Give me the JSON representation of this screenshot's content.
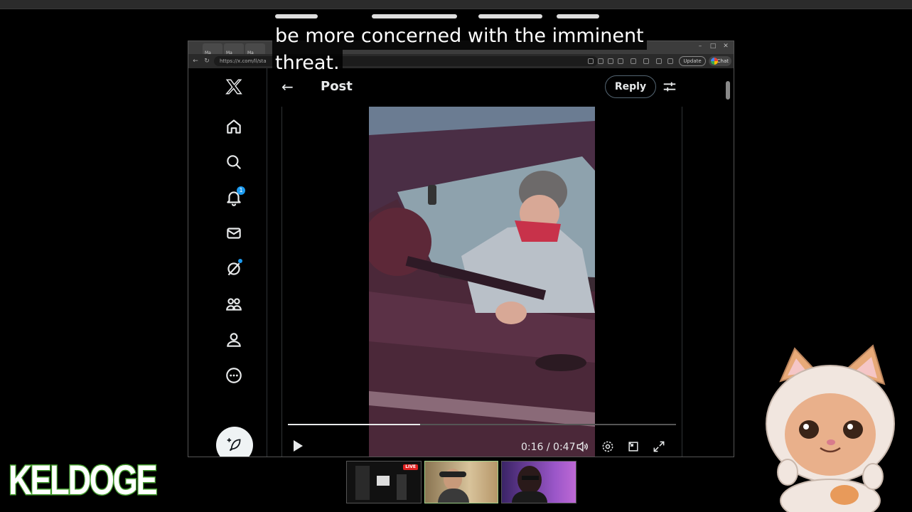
{
  "caption": {
    "line1": "be more concerned with the imminent",
    "line2": "threat."
  },
  "browser": {
    "tabs": [
      "Ma",
      "Ma",
      "Ma"
    ],
    "address": "https://x.com/ll/sta",
    "update_label": "Update",
    "chat_label": "Chat"
  },
  "sidebar": {
    "notification_count": "1",
    "items": [
      "x-logo-icon",
      "home-icon",
      "search-icon",
      "notifications-icon",
      "messages-icon",
      "grok-icon",
      "communities-icon",
      "profile-icon",
      "more-icon"
    ]
  },
  "post": {
    "title": "Post",
    "reply_label": "Reply"
  },
  "video": {
    "time_display": "0:16 / 0:47",
    "progress": 0.34
  },
  "overlay": {
    "logo_text": "KELDOGE",
    "live_label": "LIVE"
  },
  "colors": {
    "accent_blue": "#1d9bf0",
    "logo_green": "#4aa832",
    "live_red": "#e02020"
  }
}
